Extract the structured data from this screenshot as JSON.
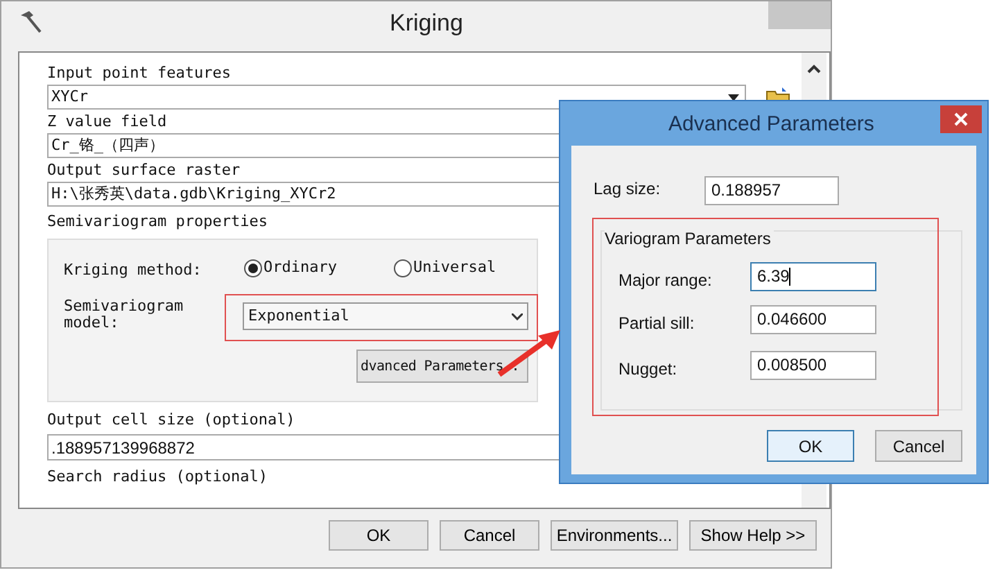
{
  "window": {
    "title": "Kriging"
  },
  "fields": [
    {
      "label": "Input point features",
      "value": "XYCr",
      "kind": "dropdown"
    },
    {
      "label": "Z value field",
      "value": "Cr_铬_（四声）",
      "kind": "text"
    },
    {
      "label": "Output surface raster",
      "value": "H:\\张秀英\\data.gdb\\Kriging_XYCr2",
      "kind": "text"
    }
  ],
  "semivariogram": {
    "title": "Semivariogram properties",
    "method_label": "Kriging method:",
    "methods": [
      {
        "label": "Ordinary",
        "selected": true
      },
      {
        "label": "Universal",
        "selected": false
      }
    ],
    "model_label": "Semivariogram model:",
    "model": "Exponential",
    "advanced_button": "dvanced Parameters.."
  },
  "cell_size": {
    "label": "Output cell size (optional)",
    "value": ".188957139968872"
  },
  "search_radius": {
    "label": "Search radius (optional)"
  },
  "buttons": [
    "OK",
    "Cancel",
    "Environments...",
    "Show Help >>"
  ],
  "dialog": {
    "title": "Advanced Parameters",
    "lag_label": "Lag size:",
    "lag": "0.188957",
    "group_title": "Variogram Parameters",
    "params": [
      {
        "label": "Major range:",
        "value": "6.39",
        "focused": true
      },
      {
        "label": "Partial sill:",
        "value": "0.046600",
        "focused": false
      },
      {
        "label": "Nugget:",
        "value": "0.008500",
        "focused": false
      }
    ],
    "buttons": [
      "OK",
      "Cancel"
    ]
  }
}
